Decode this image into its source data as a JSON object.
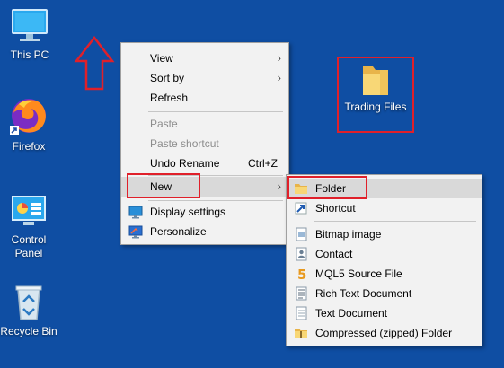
{
  "desktop": {
    "icons": [
      {
        "label": "This PC",
        "icon": "computer-icon"
      },
      {
        "label": "Firefox",
        "icon": "firefox-icon"
      },
      {
        "label": "Control Panel",
        "icon": "control-panel-icon"
      },
      {
        "label": "Recycle Bin",
        "icon": "recycle-bin-icon"
      }
    ],
    "folder": {
      "label": "Trading Files",
      "icon": "folder-icon"
    }
  },
  "context_menu": {
    "items": [
      {
        "label": "View",
        "has_submenu": true
      },
      {
        "label": "Sort by",
        "has_submenu": true
      },
      {
        "label": "Refresh"
      },
      {
        "label": "Paste",
        "disabled": true
      },
      {
        "label": "Paste shortcut",
        "disabled": true
      },
      {
        "label": "Undo Rename",
        "shortcut": "Ctrl+Z"
      },
      {
        "label": "New",
        "has_submenu": true,
        "highlighted": true
      },
      {
        "label": "Display settings",
        "icon": "display-settings-icon"
      },
      {
        "label": "Personalize",
        "icon": "personalize-icon"
      }
    ]
  },
  "new_submenu": {
    "items": [
      {
        "label": "Folder",
        "icon": "folder-icon",
        "highlighted": true
      },
      {
        "label": "Shortcut",
        "icon": "shortcut-icon"
      },
      {
        "label": "Bitmap image",
        "icon": "bitmap-icon"
      },
      {
        "label": "Contact",
        "icon": "contact-icon"
      },
      {
        "label": "MQL5 Source File",
        "icon": "mql5-icon"
      },
      {
        "label": "Rich Text Document",
        "icon": "rich-text-icon"
      },
      {
        "label": "Text Document",
        "icon": "text-document-icon"
      },
      {
        "label": "Compressed (zipped) Folder",
        "icon": "zip-folder-icon"
      }
    ]
  },
  "colors": {
    "desktop_bg": "#0f4ea3",
    "annotation_red": "#e0202a",
    "menu_bg": "#f2f2f2",
    "highlight": "#d9d9d9"
  }
}
